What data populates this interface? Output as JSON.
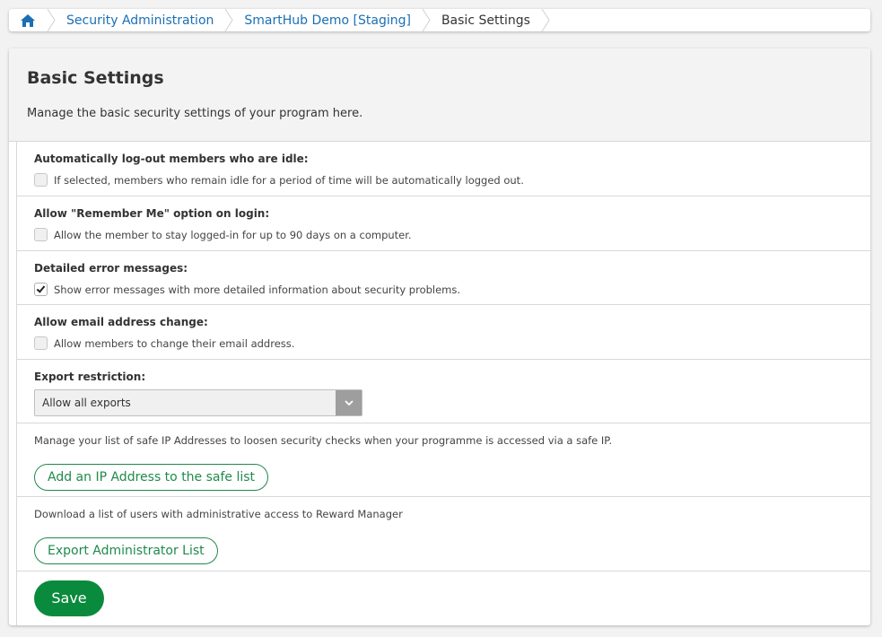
{
  "breadcrumb": {
    "home_icon": "home-icon",
    "items": [
      {
        "label": "Security Administration"
      },
      {
        "label": "SmartHub Demo [Staging]"
      },
      {
        "label": "Basic Settings"
      }
    ]
  },
  "panel": {
    "title": "Basic Settings",
    "description": "Manage the basic security settings of your program here."
  },
  "settings": {
    "idle_logout": {
      "title": "Automatically log-out members who are idle:",
      "checkbox_label": "If selected, members who remain idle for a period of time will be automatically logged out.",
      "checked": false
    },
    "remember_me": {
      "title": "Allow \"Remember Me\" option on login:",
      "checkbox_label": "Allow the member to stay logged-in for up to 90 days on a computer.",
      "checked": false
    },
    "detailed_errors": {
      "title": "Detailed error messages:",
      "checkbox_label": "Show error messages with more detailed information about security problems.",
      "checked": true
    },
    "email_change": {
      "title": "Allow email address change:",
      "checkbox_label": "Allow members to change their email address.",
      "checked": false
    },
    "export_restriction": {
      "title": "Export restriction:",
      "selected": "Allow all exports"
    }
  },
  "safe_ip": {
    "description": "Manage your list of safe IP Addresses to loosen security checks when your programme is accessed via a safe IP.",
    "button_label": "Add an IP Address to the safe list"
  },
  "admin_export": {
    "description": "Download a list of users with administrative access to Reward Manager",
    "button_label": "Export Administrator List"
  },
  "save_label": "Save",
  "colors": {
    "link": "#1a6fb5",
    "accent_green": "#0a8a3c",
    "outline_green": "#1f8a4c"
  }
}
